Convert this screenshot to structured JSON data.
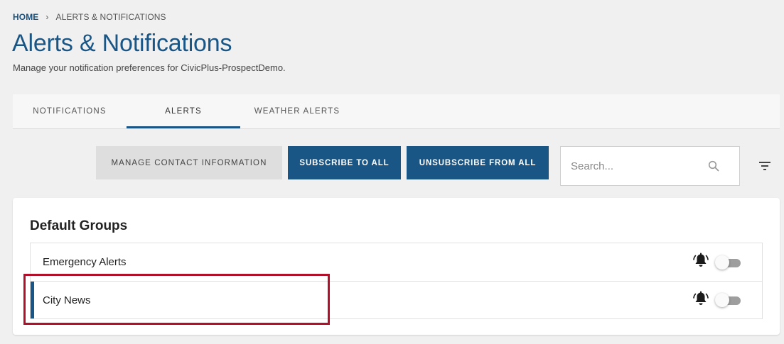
{
  "breadcrumb": {
    "home": "HOME",
    "separator": "›",
    "current": "ALERTS & NOTIFICATIONS"
  },
  "page": {
    "title": "Alerts & Notifications",
    "subtitle": "Manage your notification preferences for CivicPlus-ProspectDemo."
  },
  "tabs": [
    {
      "label": "NOTIFICATIONS",
      "active": false
    },
    {
      "label": "ALERTS",
      "active": true
    },
    {
      "label": "WEATHER ALERTS",
      "active": false
    }
  ],
  "toolbar": {
    "manage_label": "MANAGE CONTACT INFORMATION",
    "subscribe_all_label": "SUBSCRIBE TO ALL",
    "unsubscribe_all_label": "UNSUBSCRIBE FROM ALL",
    "search_placeholder": "Search...",
    "search_value": ""
  },
  "groups": {
    "title": "Default Groups",
    "items": [
      {
        "label": "Emergency Alerts",
        "icon": "bell-alert-icon",
        "subscribed": false
      },
      {
        "label": "City News",
        "icon": "bell-alert-icon",
        "subscribed": false,
        "selected": true
      }
    ]
  },
  "colors": {
    "brand": "#1a5685",
    "highlight": "#b0102a",
    "toggle_off": "#9e9e9e"
  }
}
